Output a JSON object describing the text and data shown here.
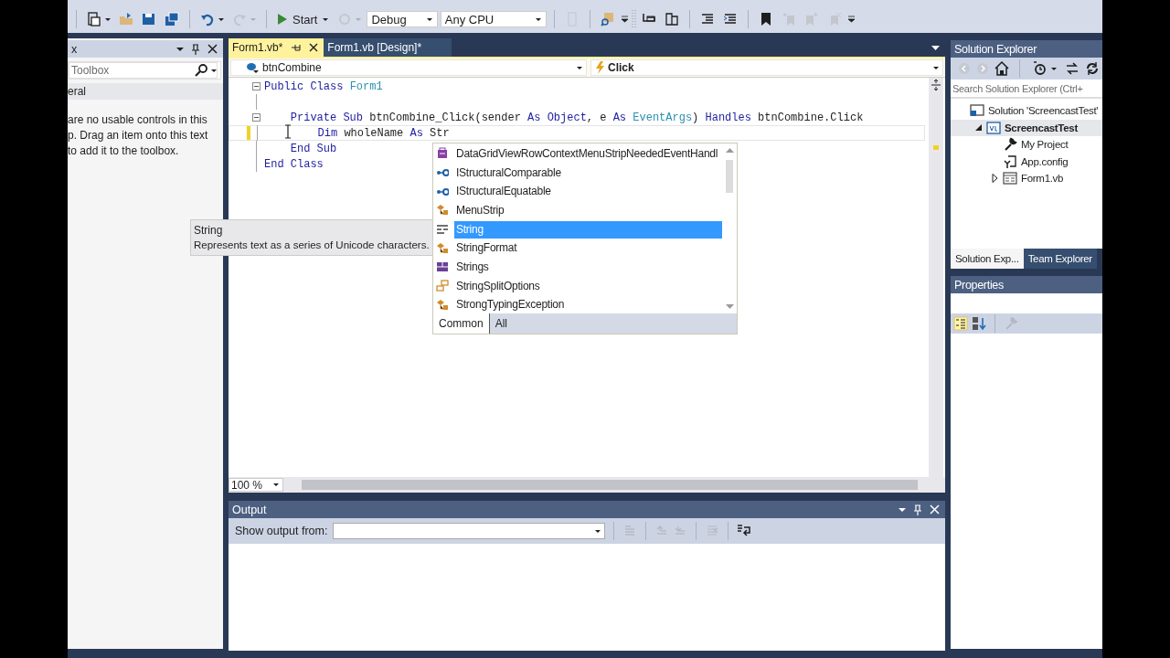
{
  "toolbar": {
    "items": [
      {
        "kind": "separator"
      },
      {
        "kind": "icon",
        "disabled": false,
        "dropdown": true
      },
      {
        "kind": "icon",
        "disabled": false
      },
      {
        "kind": "icon",
        "disabled": false
      },
      {
        "kind": "icon",
        "disabled": false
      },
      {
        "kind": "separator"
      },
      {
        "kind": "icon",
        "disabled": false,
        "dropdown": true
      },
      {
        "kind": "icon",
        "disabled": true,
        "dropdown": true
      },
      {
        "kind": "separator"
      },
      {
        "kind": "start",
        "label": "Start",
        "dropdown": true
      },
      {
        "kind": "icon",
        "disabled": true,
        "dropdown": true
      },
      {
        "kind": "combo",
        "value": "Debug"
      },
      {
        "kind": "combo",
        "value": "Any CPU"
      },
      {
        "kind": "separator"
      },
      {
        "kind": "icon",
        "disabled": true
      },
      {
        "kind": "separator"
      },
      {
        "kind": "icon",
        "disabled": false
      },
      {
        "kind": "overflow"
      },
      {
        "kind": "grip"
      },
      {
        "kind": "icon",
        "disabled": false
      },
      {
        "kind": "icon",
        "disabled": false
      },
      {
        "kind": "separator"
      },
      {
        "kind": "icon",
        "disabled": false
      },
      {
        "kind": "icon",
        "disabled": false
      },
      {
        "kind": "separator"
      },
      {
        "kind": "icon",
        "disabled": false
      },
      {
        "kind": "icon",
        "disabled": true
      },
      {
        "kind": "icon",
        "disabled": true
      },
      {
        "kind": "icon",
        "disabled": true
      },
      {
        "kind": "overflow"
      }
    ]
  },
  "toolbox": {
    "title": "x",
    "search": {
      "placeholder": "Toolbox"
    },
    "group": "eral",
    "message": [
      "are no usable controls in this",
      "p. Drag an item onto this text",
      "to add it to the toolbox."
    ]
  },
  "document_tabs": [
    {
      "label": "Form1.vb*",
      "selected": true
    },
    {
      "label": "Form1.vb [Design]*",
      "selected": false
    }
  ],
  "editor": {
    "object": "btnCombine",
    "event": "Click",
    "lines": [
      {
        "kind": "code",
        "collapsible": true,
        "tokens": [
          {
            "kind": "keyword",
            "text": "Public Class "
          },
          {
            "kind": "type",
            "text": "Form1"
          }
        ],
        "children": [
          {
            "kind": "blank"
          },
          {
            "kind": "code",
            "collapsible": true,
            "tokens": [
              {
                "kind": "keyword",
                "text": "Private Sub "
              },
              {
                "kind": "plain",
                "text": "btnCombine_Click(sender "
              },
              {
                "kind": "keyword",
                "text": "As Object"
              },
              {
                "kind": "plain",
                "text": ", e "
              },
              {
                "kind": "keyword",
                "text": "As "
              },
              {
                "kind": "type",
                "text": "EventArgs"
              },
              {
                "kind": "plain",
                "text": ") "
              },
              {
                "kind": "keyword",
                "text": "Handles "
              },
              {
                "kind": "plain",
                "text": "btnCombine.Click"
              }
            ],
            "children": [
              {
                "kind": "code",
                "changed": true,
                "current": true,
                "tokens": [
                  {
                    "kind": "keyword",
                    "text": "Dim "
                  },
                  {
                    "kind": "plain",
                    "text": "wholeName "
                  },
                  {
                    "kind": "keyword",
                    "text": "As "
                  },
                  {
                    "kind": "plain",
                    "text": "Str"
                  }
                ]
              }
            ]
          },
          {
            "kind": "code",
            "tokens": [
              {
                "kind": "keyword",
                "text": "End Sub"
              }
            ]
          }
        ]
      },
      {
        "kind": "code",
        "tokens": [
          {
            "kind": "keyword",
            "text": "End Class"
          }
        ]
      }
    ],
    "zoom": "100 %"
  },
  "completion": {
    "items": [
      {
        "kind": "delegate",
        "label": "DataGridViewRowContextMenuStripNeededEventHandl",
        "selected": false
      },
      {
        "kind": "interface",
        "label": "IStructuralComparable",
        "selected": false
      },
      {
        "kind": "interface",
        "label": "IStructuralEquatable",
        "selected": false
      },
      {
        "kind": "class",
        "label": "MenuStrip",
        "selected": false
      },
      {
        "kind": "intrinsic",
        "label": "String",
        "selected": true
      },
      {
        "kind": "class",
        "label": "StringFormat",
        "selected": false
      },
      {
        "kind": "module",
        "label": "Strings",
        "selected": false
      },
      {
        "kind": "enum",
        "label": "StringSplitOptions",
        "selected": false
      },
      {
        "kind": "class",
        "label": "StrongTypingException",
        "selected": false
      }
    ],
    "tabs": [
      {
        "label": "Common",
        "selected": true
      },
      {
        "label": "All",
        "selected": false
      }
    ]
  },
  "tooltip": {
    "title": "String",
    "description": "Represents text as a series of Unicode characters."
  },
  "solution_explorer": {
    "title": "Solution Explorer",
    "search": {
      "placeholder": "Search Solution Explorer (Ctrl+"
    },
    "tree": [
      {
        "kind": "solution",
        "label": "Solution 'ScreencastTest'",
        "selected": false,
        "children": [
          {
            "kind": "project",
            "label": "ScreencastTest",
            "selected": true,
            "expanded": true,
            "children": [
              {
                "kind": "settings",
                "label": "My Project",
                "selected": false
              },
              {
                "kind": "config",
                "label": "App.config",
                "selected": false
              },
              {
                "kind": "form",
                "label": "Form1.vb",
                "selected": false,
                "expanded": false
              }
            ]
          }
        ]
      }
    ],
    "tabs": [
      {
        "label": "Solution Exp...",
        "selected": true
      },
      {
        "label": "Team Explorer",
        "selected": false
      }
    ]
  },
  "properties": {
    "title": "Properties"
  },
  "output": {
    "title": "Output",
    "source_label": "Show output from:"
  }
}
